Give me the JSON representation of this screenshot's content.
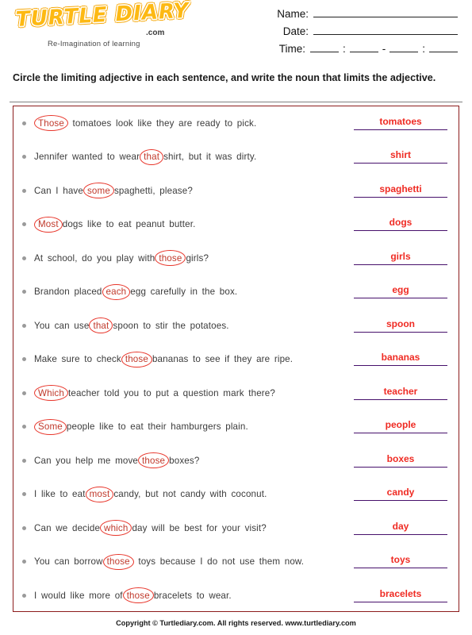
{
  "brand": {
    "logo_text": "TURTLE DIARY",
    "logo_suffix": ".com",
    "tagline": "Re-Imagination of learning",
    "logo_color": "#fdb913"
  },
  "header_fields": {
    "name_label": "Name:",
    "date_label": "Date:",
    "time_label": "Time:",
    "time_separator": ":",
    "time_dash": "-"
  },
  "instruction": {
    "text": "Circle the limiting adjective in each sentence, and write the noun that limits the adjective."
  },
  "colors": {
    "box_border": "#8c1c1c",
    "circle_red": "#e8352a",
    "answer_red": "#ef2b23",
    "answer_line": "#46106b",
    "bullet_gray": "#9a9a9a",
    "sentence_text": "#3b3b3b"
  },
  "rows": [
    {
      "pre": "",
      "circled": "Those",
      "post": " tomatoes look like they are ready to pick.",
      "answer": "tomatoes"
    },
    {
      "pre": "Jennifer wanted to wear",
      "circled": "that",
      "post": "shirt, but it was dirty.",
      "answer": "shirt"
    },
    {
      "pre": "Can I have",
      "circled": "some",
      "post": "spaghetti, please?",
      "answer": "spaghetti"
    },
    {
      "pre": "",
      "circled": "Most",
      "post": "dogs like to eat peanut butter.",
      "answer": "dogs"
    },
    {
      "pre": "At school, do you play with",
      "circled": "those",
      "post": "girls?",
      "answer": "girls"
    },
    {
      "pre": "Brandon placed",
      "circled": "each",
      "post": "egg carefully in the box.",
      "answer": "egg"
    },
    {
      "pre": "You can use",
      "circled": "that",
      "post": "spoon to stir the potatoes.",
      "answer": "spoon"
    },
    {
      "pre": "Make sure to check",
      "circled": "those",
      "post": "bananas to see if they are ripe.",
      "answer": "bananas"
    },
    {
      "pre": "",
      "circled": "Which",
      "post": "teacher told you to put a question mark there?",
      "answer": "teacher"
    },
    {
      "pre": "",
      "circled": "Some",
      "post": "people like to eat their hamburgers plain.",
      "answer": "people"
    },
    {
      "pre": "Can you help me move",
      "circled": "those",
      "post": "boxes?",
      "answer": "boxes"
    },
    {
      "pre": "I like to eat",
      "circled": "most",
      "post": "candy, but not candy with coconut.",
      "answer": "candy"
    },
    {
      "pre": "Can we decide",
      "circled": "which",
      "post": "day will be best for your visit?",
      "answer": "day"
    },
    {
      "pre": "You can borrow",
      "circled": "those",
      "post": " toys because I do not use them now.",
      "answer": "toys"
    },
    {
      "pre": "I would like more of",
      "circled": "those",
      "post": "bracelets to wear.",
      "answer": "bracelets"
    }
  ],
  "footer": {
    "text": "Copyright © Turtlediary.com. All rights reserved. www.turtlediary.com"
  }
}
